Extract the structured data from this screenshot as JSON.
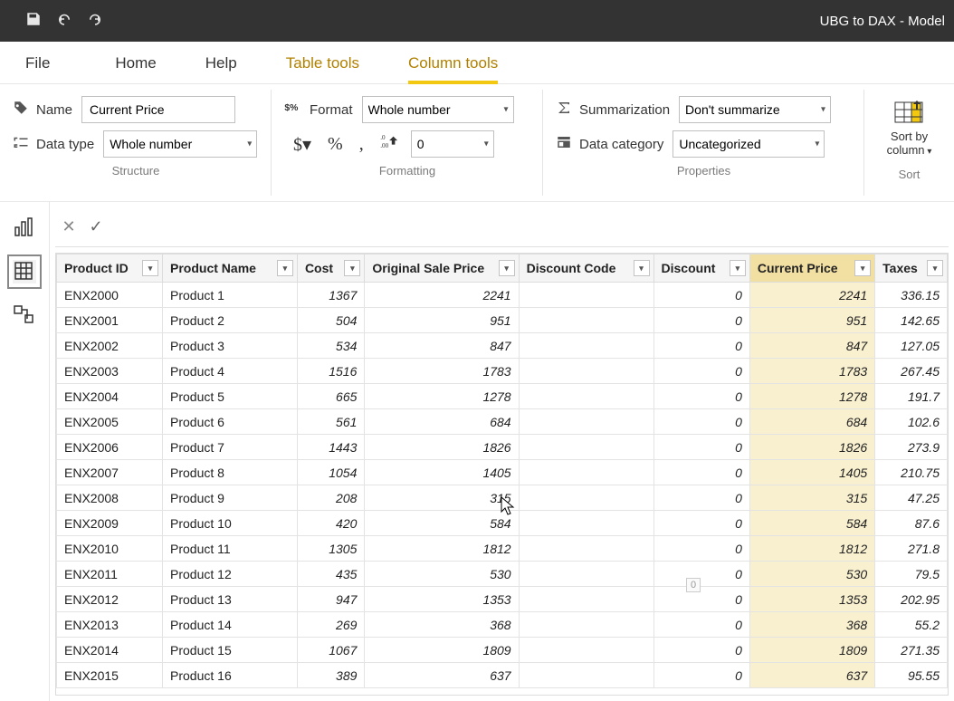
{
  "app": {
    "title": "UBG to DAX - Model"
  },
  "menu": {
    "file": "File",
    "home": "Home",
    "help": "Help",
    "tabletools": "Table tools",
    "columntools": "Column tools"
  },
  "ribbon": {
    "structure": {
      "name_label": "Name",
      "name_value": "Current Price",
      "datatype_label": "Data type",
      "datatype_value": "Whole number",
      "group_label": "Structure"
    },
    "formatting": {
      "format_label": "Format",
      "format_value": "Whole number",
      "decimal_value": "0",
      "group_label": "Formatting"
    },
    "properties": {
      "summarization_label": "Summarization",
      "summarization_value": "Don't summarize",
      "datacategory_label": "Data category",
      "datacategory_value": "Uncategorized",
      "group_label": "Properties"
    },
    "sort": {
      "label1": "Sort by",
      "label2": "column",
      "group_label": "Sort"
    }
  },
  "grid": {
    "columns": [
      "Product ID",
      "Product Name",
      "Cost",
      "Original Sale Price",
      "Discount Code",
      "Discount",
      "Current Price",
      "Taxes"
    ],
    "selected_column_index": 6,
    "rows": [
      {
        "pid": "ENX2000",
        "pname": "Product 1",
        "cost": "1367",
        "osp": "2241",
        "dc": "",
        "disc": "0",
        "cp": "2241",
        "tax": "336.15"
      },
      {
        "pid": "ENX2001",
        "pname": "Product 2",
        "cost": "504",
        "osp": "951",
        "dc": "",
        "disc": "0",
        "cp": "951",
        "tax": "142.65"
      },
      {
        "pid": "ENX2002",
        "pname": "Product 3",
        "cost": "534",
        "osp": "847",
        "dc": "",
        "disc": "0",
        "cp": "847",
        "tax": "127.05"
      },
      {
        "pid": "ENX2003",
        "pname": "Product 4",
        "cost": "1516",
        "osp": "1783",
        "dc": "",
        "disc": "0",
        "cp": "1783",
        "tax": "267.45"
      },
      {
        "pid": "ENX2004",
        "pname": "Product 5",
        "cost": "665",
        "osp": "1278",
        "dc": "",
        "disc": "0",
        "cp": "1278",
        "tax": "191.7"
      },
      {
        "pid": "ENX2005",
        "pname": "Product 6",
        "cost": "561",
        "osp": "684",
        "dc": "",
        "disc": "0",
        "cp": "684",
        "tax": "102.6"
      },
      {
        "pid": "ENX2006",
        "pname": "Product 7",
        "cost": "1443",
        "osp": "1826",
        "dc": "",
        "disc": "0",
        "cp": "1826",
        "tax": "273.9"
      },
      {
        "pid": "ENX2007",
        "pname": "Product 8",
        "cost": "1054",
        "osp": "1405",
        "dc": "",
        "disc": "0",
        "cp": "1405",
        "tax": "210.75"
      },
      {
        "pid": "ENX2008",
        "pname": "Product 9",
        "cost": "208",
        "osp": "315",
        "dc": "",
        "disc": "0",
        "cp": "315",
        "tax": "47.25"
      },
      {
        "pid": "ENX2009",
        "pname": "Product 10",
        "cost": "420",
        "osp": "584",
        "dc": "",
        "disc": "0",
        "cp": "584",
        "tax": "87.6"
      },
      {
        "pid": "ENX2010",
        "pname": "Product 11",
        "cost": "1305",
        "osp": "1812",
        "dc": "",
        "disc": "0",
        "cp": "1812",
        "tax": "271.8"
      },
      {
        "pid": "ENX2011",
        "pname": "Product 12",
        "cost": "435",
        "osp": "530",
        "dc": "",
        "disc": "0",
        "cp": "530",
        "tax": "79.5"
      },
      {
        "pid": "ENX2012",
        "pname": "Product 13",
        "cost": "947",
        "osp": "1353",
        "dc": "",
        "disc": "0",
        "cp": "1353",
        "tax": "202.95"
      },
      {
        "pid": "ENX2013",
        "pname": "Product 14",
        "cost": "269",
        "osp": "368",
        "dc": "",
        "disc": "0",
        "cp": "368",
        "tax": "55.2"
      },
      {
        "pid": "ENX2014",
        "pname": "Product 15",
        "cost": "1067",
        "osp": "1809",
        "dc": "",
        "disc": "0",
        "cp": "1809",
        "tax": "271.35"
      },
      {
        "pid": "ENX2015",
        "pname": "Product 16",
        "cost": "389",
        "osp": "637",
        "dc": "",
        "disc": "0",
        "cp": "637",
        "tax": "95.55"
      }
    ]
  },
  "floater": "0"
}
